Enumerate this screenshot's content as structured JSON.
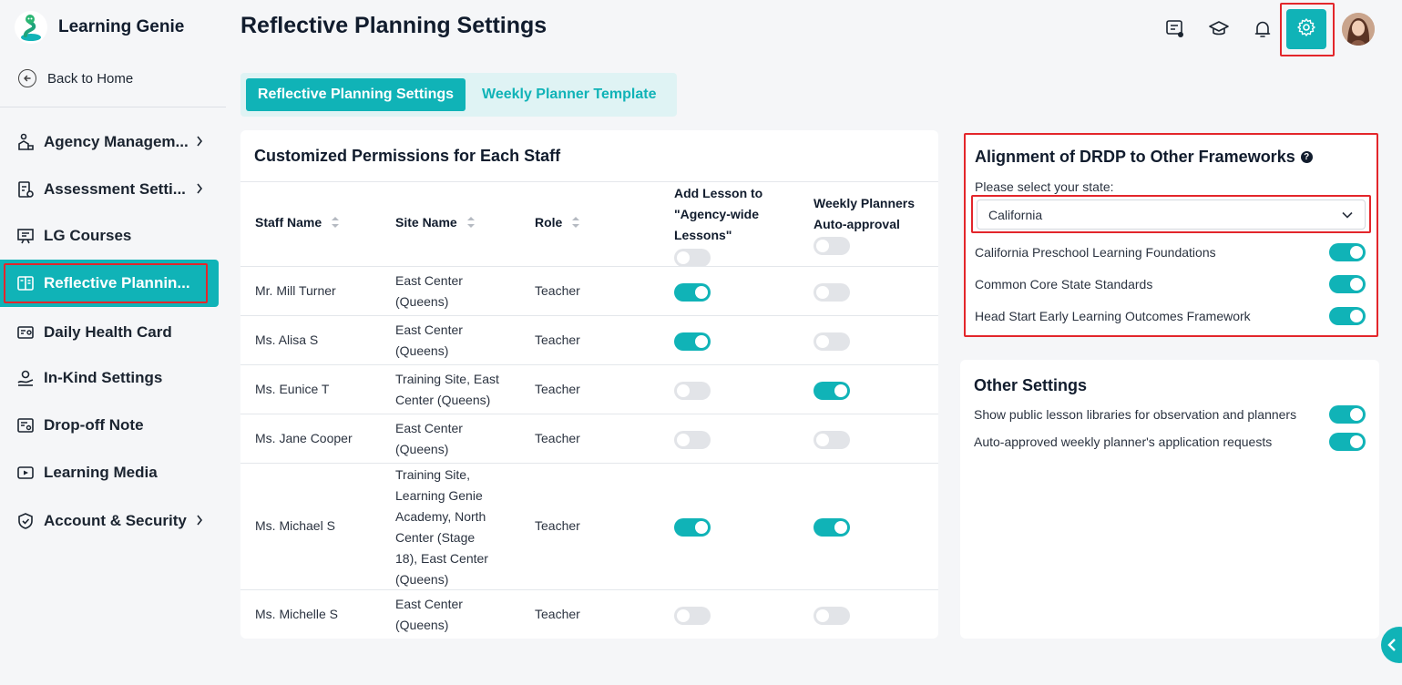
{
  "app": {
    "brand_name": "Learning Genie",
    "page_title": "Reflective Planning Settings"
  },
  "sidebar": {
    "back_home": "Back to Home",
    "items": [
      {
        "label": "Agency Managem...",
        "icon": "agency-icon",
        "has_chevron": true
      },
      {
        "label": "Assessment Setti...",
        "icon": "assessment-icon",
        "has_chevron": true
      },
      {
        "label": "LG Courses",
        "icon": "courses-icon",
        "has_chevron": false
      },
      {
        "label": "Reflective Plannin...",
        "icon": "book-icon",
        "has_chevron": false,
        "active": true
      },
      {
        "label": "Daily Health Card",
        "icon": "health-card-icon",
        "has_chevron": false
      },
      {
        "label": "In-Kind Settings",
        "icon": "in-kind-icon",
        "has_chevron": false
      },
      {
        "label": "Drop-off Note",
        "icon": "note-icon",
        "has_chevron": false
      },
      {
        "label": "Learning Media",
        "icon": "media-icon",
        "has_chevron": false
      },
      {
        "label": "Account & Security",
        "icon": "shield-icon",
        "has_chevron": true
      }
    ]
  },
  "header": {
    "icons": [
      "feedback-icon",
      "graduation-cap-icon",
      "bell-icon",
      "gear-icon",
      "avatar"
    ]
  },
  "tabs": [
    {
      "label": "Reflective Planning Settings",
      "active": true
    },
    {
      "label": "Weekly Planner Template",
      "active": false
    }
  ],
  "permissions": {
    "title": "Customized Permissions for Each Staff",
    "columns": {
      "staff": "Staff Name",
      "site": "Site Name",
      "role": "Role",
      "add_lesson_1": "Add Lesson to",
      "add_lesson_2": "\"Agency-wide",
      "add_lesson_3": "Lessons\"",
      "weekly_1": "Weekly Planners",
      "weekly_2": "Auto-approval"
    },
    "header_toggles": {
      "add_lesson_all": false,
      "weekly_all": false
    },
    "rows": [
      {
        "name": "Mr. Mill Turner",
        "site": [
          "East Center",
          "(Queens)"
        ],
        "role": "Teacher",
        "add_lesson": true,
        "auto_approval": false
      },
      {
        "name": "Ms. Alisa S",
        "site": [
          "East Center",
          "(Queens)"
        ],
        "role": "Teacher",
        "add_lesson": true,
        "auto_approval": false
      },
      {
        "name": "Ms. Eunice T",
        "site": [
          "Training Site, East",
          "Center (Queens)"
        ],
        "role": "Teacher",
        "add_lesson": false,
        "auto_approval": true
      },
      {
        "name": "Ms. Jane Cooper",
        "site": [
          "East Center",
          "(Queens)"
        ],
        "role": "Teacher",
        "add_lesson": false,
        "auto_approval": false
      },
      {
        "name": "Ms. Michael S",
        "site": [
          "Training Site,",
          "Learning Genie",
          "Academy, North",
          "Center (Stage",
          "18), East Center",
          "(Queens)"
        ],
        "role": "Teacher",
        "add_lesson": true,
        "auto_approval": true
      },
      {
        "name": "Ms. Michelle S",
        "site": [
          "East Center",
          "(Queens)"
        ],
        "role": "Teacher",
        "add_lesson": false,
        "auto_approval": false
      }
    ]
  },
  "alignment": {
    "title": "Alignment of DRDP to Other Frameworks",
    "help": "?",
    "state_label": "Please select your state:",
    "state_value": "California",
    "frameworks": [
      {
        "label": "California Preschool Learning Foundations",
        "enabled": true
      },
      {
        "label": "Common Core State Standards",
        "enabled": true
      },
      {
        "label": "Head Start Early Learning Outcomes Framework",
        "enabled": true
      }
    ]
  },
  "other_settings": {
    "title": "Other Settings",
    "items": [
      {
        "label": "Show public lesson libraries for observation and planners",
        "enabled": true
      },
      {
        "label": "Auto-approved weekly planner's application requests",
        "enabled": true
      }
    ]
  },
  "colors": {
    "accent": "#10b3b7",
    "highlight": "#e3262b"
  }
}
